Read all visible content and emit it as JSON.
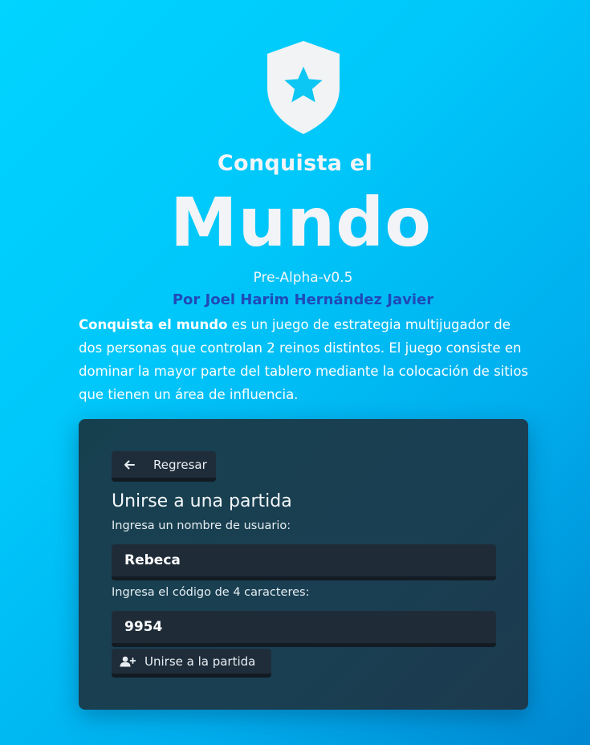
{
  "header": {
    "logo_icon": "shield-star-icon",
    "subtitle": "Conquista el",
    "title": "Mundo",
    "version": "Pre-Alpha-v0.5",
    "author": "Por Joel Harim Hernández Javier"
  },
  "description": {
    "bold_text": "Conquista el mundo",
    "text": " es un juego de estrategia multijugador de dos personas que controlan 2 reinos distintos. El juego consiste en dominar la mayor parte del tablero mediante la colocación de sitios que tienen un área de influencia."
  },
  "card": {
    "back_button": {
      "icon": "arrow-left-icon",
      "label": "Regresar"
    },
    "title": "Unirse a una partida",
    "username_label": "Ingresa un nombre de usuario:",
    "username_value": "Rebeca",
    "code_label": "Ingresa el código de 4 caracteres:",
    "code_value": "9954",
    "join_button": {
      "icon": "user-plus-icon",
      "label": "Unirse a la partida"
    }
  },
  "colors": {
    "background_start": "#00d4ff",
    "background_end": "#0087d0",
    "card": "#1a3f52",
    "author": "#1f4ab8",
    "button": "#1f2d3a"
  }
}
